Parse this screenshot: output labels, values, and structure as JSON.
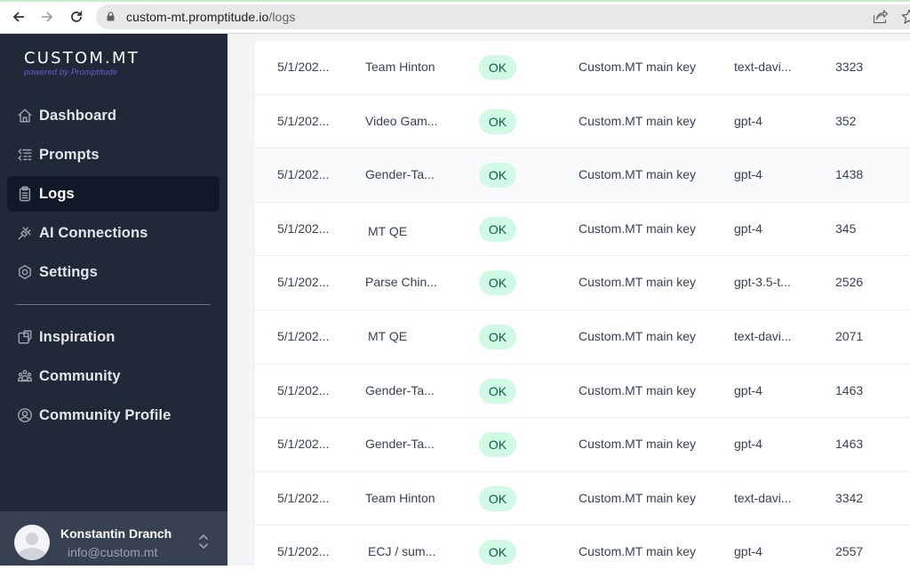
{
  "browser": {
    "url_host": "custom-mt.promptitude.io",
    "url_path": "/logs",
    "back_icon": "arrow-left-icon",
    "forward_icon": "arrow-right-icon",
    "reload_icon": "reload-icon",
    "lock_icon": "lock-icon",
    "share_icon": "share-icon",
    "star_icon": "star-icon"
  },
  "brand": {
    "wordmark": "CUSTOM.MT",
    "tagline": "powered by Promptitude",
    "tagline_color": "#6d5dd3"
  },
  "sidebar": {
    "primary": [
      {
        "label": "Dashboard",
        "icon": "home-icon",
        "active": false
      },
      {
        "label": "Prompts",
        "icon": "prompts-list-icon",
        "active": false
      },
      {
        "label": "Logs",
        "icon": "clipboard-icon",
        "active": true
      },
      {
        "label": "AI Connections",
        "icon": "plug-icon",
        "active": false
      },
      {
        "label": "Settings",
        "icon": "gear-icon",
        "active": false
      }
    ],
    "secondary": [
      {
        "label": "Inspiration",
        "icon": "inspiration-icon"
      },
      {
        "label": "Community",
        "icon": "users-icon"
      },
      {
        "label": "Community Profile",
        "icon": "user-circle-icon"
      }
    ]
  },
  "user": {
    "name": "Konstantin Dranch",
    "email": "info@custom.mt"
  },
  "colors": {
    "sidebar_bg": "#1f2937",
    "active_item_bg": "#111827",
    "badge_bg": "#d1fae5",
    "badge_text": "#065f46"
  },
  "logs": {
    "rows": [
      {
        "date": "5/1/202...",
        "prompt": "Team Hinton",
        "status": "OK",
        "key": "Custom.MT main key",
        "model": "text-davi...",
        "tokens": "3323"
      },
      {
        "date": "5/1/202...",
        "prompt": "Video Gam...",
        "status": "OK",
        "key": "Custom.MT main key",
        "model": "gpt-4",
        "tokens": "352"
      },
      {
        "date": "5/1/202...",
        "prompt": "Gender-Ta...",
        "status": "OK",
        "key": "Custom.MT main key",
        "model": "gpt-4",
        "tokens": "1438"
      },
      {
        "date": "5/1/202...",
        "prompt": "MT QE",
        "status": "OK",
        "key": "Custom.MT main key",
        "model": "gpt-4",
        "tokens": "345"
      },
      {
        "date": "5/1/202...",
        "prompt": "Parse Chin...",
        "status": "OK",
        "key": "Custom.MT main key",
        "model": "gpt-3.5-t...",
        "tokens": "2526"
      },
      {
        "date": "5/1/202...",
        "prompt": "MT QE",
        "status": "OK",
        "key": "Custom.MT main key",
        "model": "text-davi...",
        "tokens": "2071"
      },
      {
        "date": "5/1/202...",
        "prompt": "Gender-Ta...",
        "status": "OK",
        "key": "Custom.MT main key",
        "model": "gpt-4",
        "tokens": "1463"
      },
      {
        "date": "5/1/202...",
        "prompt": "Gender-Ta...",
        "status": "OK",
        "key": "Custom.MT main key",
        "model": "gpt-4",
        "tokens": "1463"
      },
      {
        "date": "5/1/202...",
        "prompt": "Team Hinton",
        "status": "OK",
        "key": "Custom.MT main key",
        "model": "text-davi...",
        "tokens": "3342"
      },
      {
        "date": "5/1/202...",
        "prompt": "ECJ / sum...",
        "status": "OK",
        "key": "Custom.MT main key",
        "model": "gpt-4",
        "tokens": "2557"
      }
    ]
  }
}
